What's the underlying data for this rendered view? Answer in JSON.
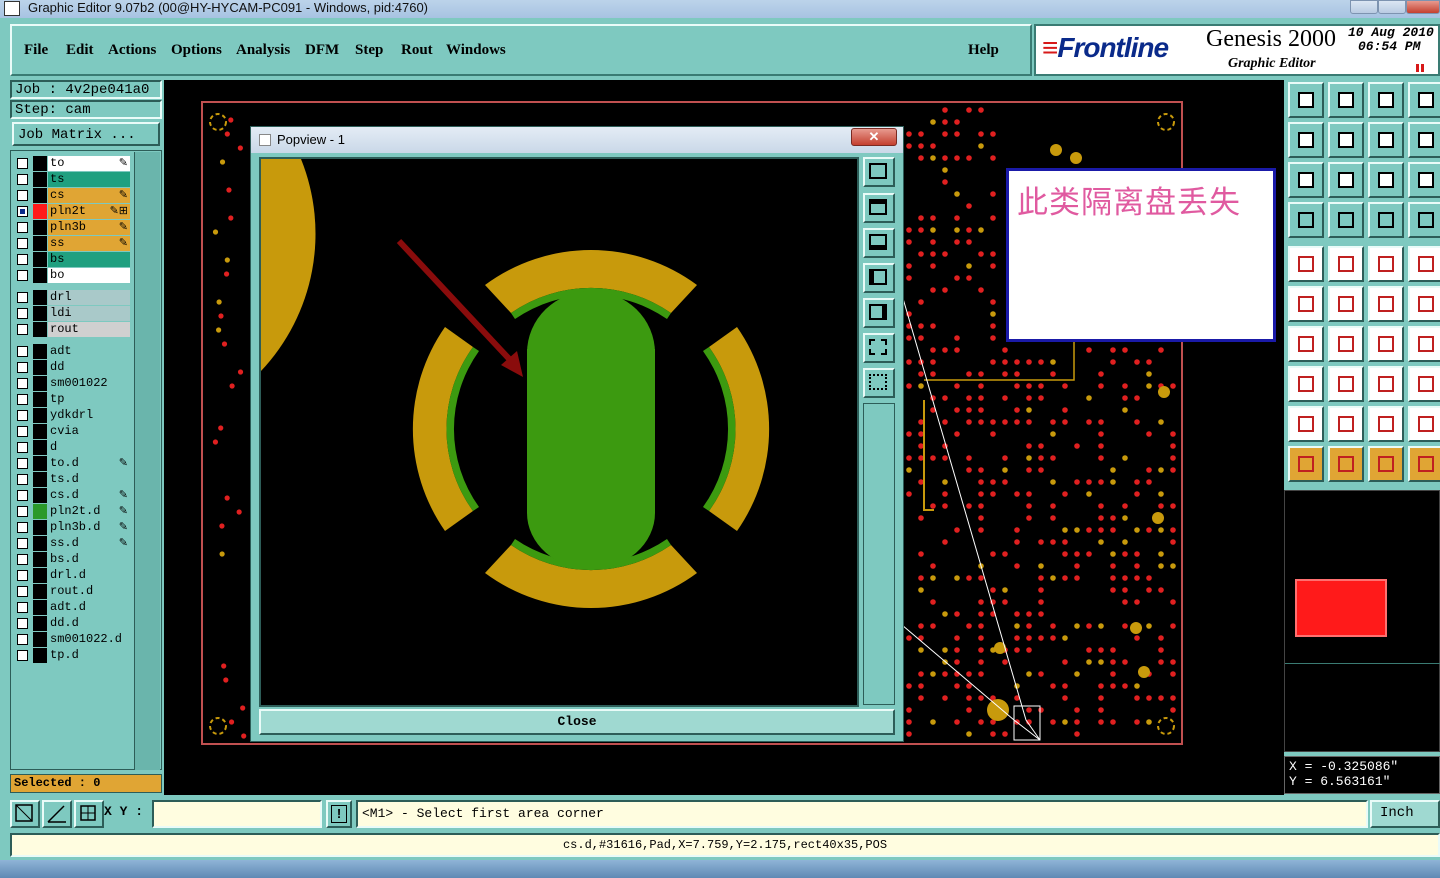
{
  "window": {
    "title": "Graphic Editor 9.07b2 (00@HY-HYCAM-PC091 - Windows, pid:4760)"
  },
  "menu": {
    "items": [
      "File",
      "Edit",
      "Actions",
      "Options",
      "Analysis",
      "DFM",
      "Step",
      "Rout",
      "Windows"
    ],
    "help": "Help"
  },
  "brand": {
    "logo": "Frontline",
    "product": "Genesis 2000",
    "subtitle": "Graphic Editor",
    "date": "10 Aug 2010",
    "time": "06:54 PM"
  },
  "job": {
    "job_line": "Job : 4v2pe041a0",
    "step_line": "Step: cam",
    "matrix_button": "Job Matrix ..."
  },
  "layers": [
    {
      "name": "to",
      "color": "#ffffff",
      "mark": "✎"
    },
    {
      "name": "ts",
      "color": "#20a080",
      "mark": ""
    },
    {
      "name": "cs",
      "color": "#e0a534",
      "mark": "✎"
    },
    {
      "name": "pln2t",
      "color": "#e0a534",
      "mark": "✎⊞",
      "active": true,
      "swatch": "#ff1a1a"
    },
    {
      "name": "pln3b",
      "color": "#e0a534",
      "mark": "✎"
    },
    {
      "name": "ss",
      "color": "#e0a534",
      "mark": "✎"
    },
    {
      "name": "bs",
      "color": "#20a080",
      "mark": ""
    },
    {
      "name": "bo",
      "color": "#ffffff",
      "mark": ""
    },
    {
      "name": "drl",
      "color": "#a9c9c9",
      "mark": "",
      "gap": true
    },
    {
      "name": "ldi",
      "color": "#a9c9c9",
      "mark": ""
    },
    {
      "name": "rout",
      "color": "#d0d0d0",
      "mark": ""
    },
    {
      "name": "adt",
      "color": "#7ec9c0",
      "mark": "",
      "gap": true
    },
    {
      "name": "dd",
      "color": "#7ec9c0",
      "mark": ""
    },
    {
      "name": "sm001022",
      "color": "#7ec9c0",
      "mark": ""
    },
    {
      "name": "tp",
      "color": "#7ec9c0",
      "mark": ""
    },
    {
      "name": "ydkdrl",
      "color": "#7ec9c0",
      "mark": ""
    },
    {
      "name": "cvia",
      "color": "#7ec9c0",
      "mark": ""
    },
    {
      "name": "d",
      "color": "#7ec9c0",
      "mark": ""
    },
    {
      "name": "to.d",
      "color": "#7ec9c0",
      "mark": "✎"
    },
    {
      "name": "ts.d",
      "color": "#7ec9c0",
      "mark": ""
    },
    {
      "name": "cs.d",
      "color": "#7ec9c0",
      "mark": "✎"
    },
    {
      "name": "pln2t.d",
      "color": "#7ec9c0",
      "mark": "✎",
      "swatch": "#2a9a2a"
    },
    {
      "name": "pln3b.d",
      "color": "#7ec9c0",
      "mark": "✎"
    },
    {
      "name": "ss.d",
      "color": "#7ec9c0",
      "mark": "✎"
    },
    {
      "name": "bs.d",
      "color": "#7ec9c0",
      "mark": ""
    },
    {
      "name": "drl.d",
      "color": "#7ec9c0",
      "mark": ""
    },
    {
      "name": "rout.d",
      "color": "#7ec9c0",
      "mark": ""
    },
    {
      "name": "adt.d",
      "color": "#7ec9c0",
      "mark": ""
    },
    {
      "name": "dd.d",
      "color": "#7ec9c0",
      "mark": ""
    },
    {
      "name": "sm001022.d",
      "color": "#7ec9c0",
      "mark": ""
    },
    {
      "name": "tp.d",
      "color": "#7ec9c0",
      "mark": ""
    }
  ],
  "popview": {
    "title": "Popview - 1",
    "close_x": "✕",
    "close_button": "Close"
  },
  "note": {
    "text": "此类隔离盘丢失"
  },
  "status": {
    "selected": "Selected : 0",
    "x": "X = -0.325086\"",
    "y": "Y = 6.563161\"",
    "xy_label": "X Y :",
    "xy_value": "",
    "prompt": "<M1> - Select first area corner",
    "units": "Inch",
    "feature_info": "cs.d,#31616,Pad,X=7.759,Y=2.175,rect40x35,POS"
  },
  "colors": {
    "panel": "#7ec9c0",
    "copper": "#c89a0c",
    "green": "#3c9a10",
    "arrow": "#8a0c0c",
    "selection": "#ff1a1a"
  }
}
